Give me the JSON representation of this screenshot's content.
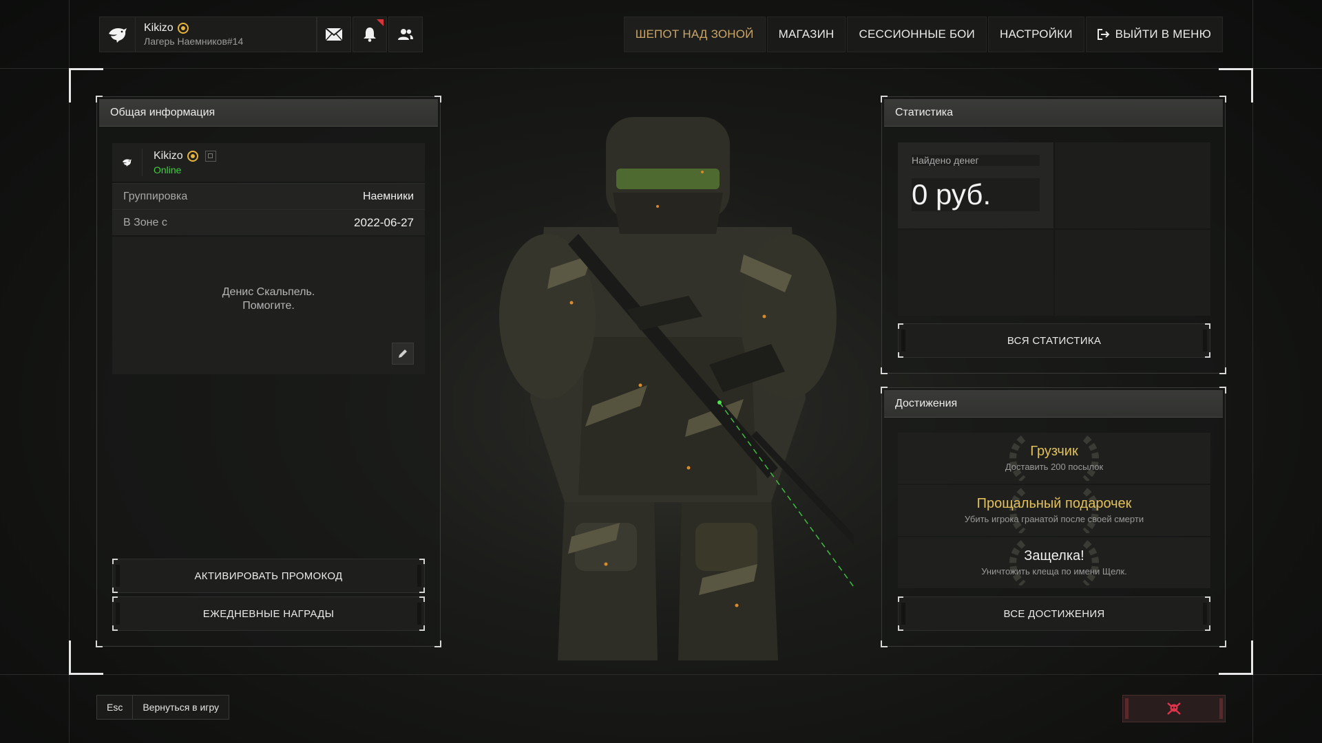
{
  "profile": {
    "nickname": "Kikizo",
    "subtitle": "Лагерь Наемников#14"
  },
  "icons": {
    "faction": "eagle-icon",
    "badge": "rank-badge-icon",
    "mail": "mail-icon",
    "notifications": "bell-icon",
    "friends": "friends-icon",
    "exit": "exit-icon",
    "edit": "pencil-icon",
    "copy": "copy-icon",
    "kill": "skull-icon"
  },
  "nav": {
    "items": [
      "ШЕПОТ НАД ЗОНОЙ",
      "МАГАЗИН",
      "СЕССИОННЫЕ БОИ",
      "НАСТРОЙКИ"
    ],
    "exit_label": "ВЫЙТИ В МЕНЮ"
  },
  "general": {
    "title": "Общая информация",
    "nickname": "Kikizo",
    "status": "Online",
    "rows": [
      {
        "key": "Группировка",
        "value": "Наемники"
      },
      {
        "key": "В Зоне с",
        "value": "2022-06-27"
      }
    ],
    "bio_line1": "Денис Скальпель.",
    "bio_line2": "Помогите.",
    "promo_button": "АКТИВИРОВАТЬ ПРОМОКОД",
    "daily_button": "ЕЖЕДНЕВНЫЕ НАГРАДЫ"
  },
  "stats": {
    "title": "Статистика",
    "money_label": "Найдено денег",
    "money_value": "0 руб.",
    "all_button": "ВСЯ СТАТИСТИКА"
  },
  "achievements": {
    "title": "Достижения",
    "items": [
      {
        "title": "Грузчик",
        "desc": "Доставить 200 посылок"
      },
      {
        "title": "Прощальный подарочек",
        "desc": "Убить игрока гранатой после своей смерти"
      },
      {
        "title": "Защелка!",
        "desc": "Уничтожить клеща по имени Щелк."
      }
    ],
    "all_button": "ВСЕ ДОСТИЖЕНИЯ"
  },
  "footer": {
    "esc_key": "Esc",
    "back_label": "Вернуться в игру"
  },
  "colors": {
    "online": "#3fcf3f",
    "gold": "#e3c15a",
    "active_nav": "#c9a56a",
    "notification": "#d9343a",
    "kill": "#e0344a"
  }
}
